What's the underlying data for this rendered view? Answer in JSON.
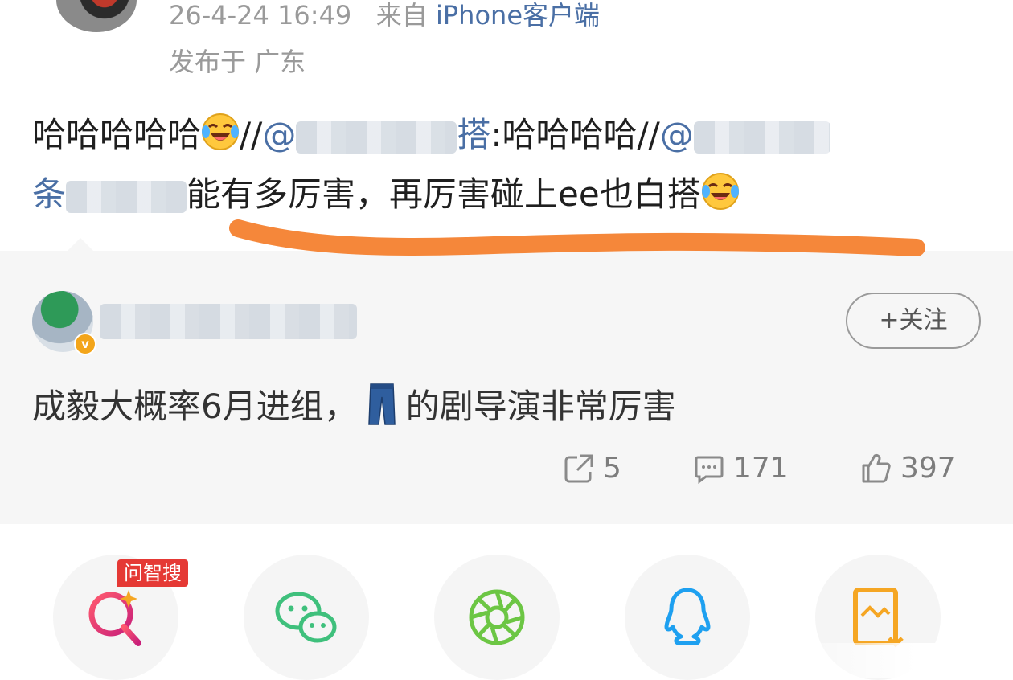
{
  "header": {
    "timestamp": "26-4-24 16:49",
    "source_prefix": "来自",
    "source_name": "iPhone客户端",
    "location": "发布于 广东"
  },
  "post": {
    "line1_text": "哈哈哈哈哈",
    "line1_sep": "//",
    "line1_mention_tail": "搭",
    "line1_colon_text": ":哈哈哈哈",
    "line1_sep2": "//",
    "line2_mention_head": "条",
    "line2_text": "能有多厉害，再厉害碰上ee也白搭",
    "emoji_icon": "laughing-tears-emoji",
    "underline_color": "#f5873a"
  },
  "repost": {
    "follow_label": "+关注",
    "text_before": "成毅大概率6月进组，",
    "text_after": "的剧导演非常厉害",
    "jeans_icon": "jeans-emoji",
    "verified_badge": "v",
    "stats": {
      "repost_count": "5",
      "comment_count": "171",
      "like_count": "397"
    }
  },
  "share_bar": {
    "badge": "问智搜",
    "items": [
      "zhisou-search-icon",
      "wechat-icon",
      "moments-icon",
      "qq-icon",
      "save-image-icon"
    ]
  },
  "colors": {
    "accent_blue": "#4a6fa5",
    "card_bg": "#f6f6f6",
    "badge_red": "#e53935",
    "wechat_green": "#3fc07c",
    "moments_green": "#6cc644",
    "qq_blue": "#1ea0f0",
    "save_orange": "#f5a623"
  }
}
